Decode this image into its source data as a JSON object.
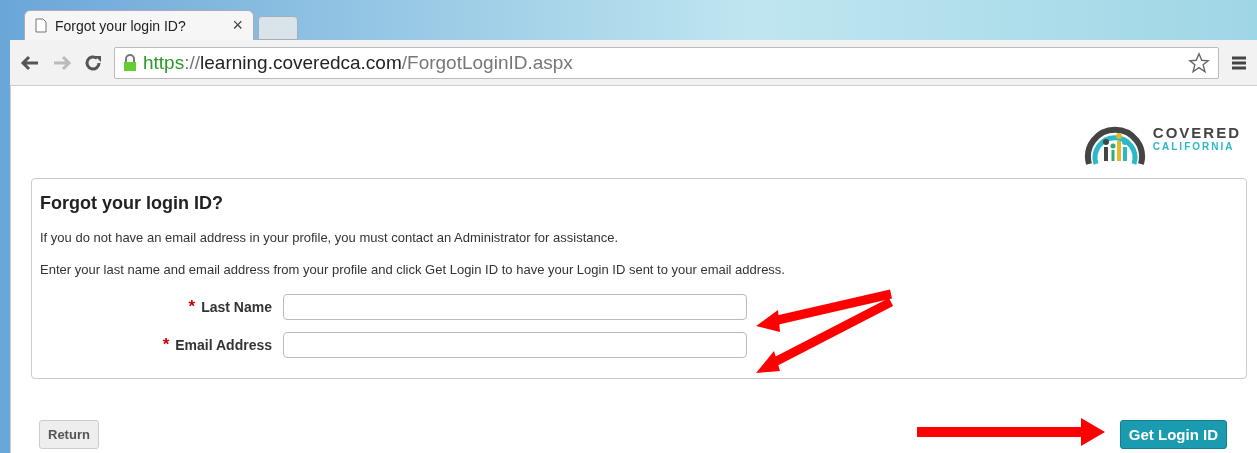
{
  "browser": {
    "tab_title": "Forgot your login ID?",
    "tab_close": "×",
    "url": [
      {
        "kind": "scheme",
        "text": "https"
      },
      {
        "kind": "sep",
        "text": "://"
      },
      {
        "kind": "host",
        "text": "learning.coveredca.com"
      },
      {
        "kind": "path",
        "text": "/ForgotLoginID.aspx"
      }
    ]
  },
  "logo": {
    "line1": "COVERED",
    "line2": "CALIFORNIA"
  },
  "form": {
    "title": "Forgot your login ID?",
    "notes": [
      "If you do not have an email address in your profile, you must contact an Administrator for assistance.",
      "Enter your last name and email address from your profile and click Get Login ID to have your Login ID sent to your email address."
    ],
    "fields": [
      {
        "marker": "*",
        "label": "Last Name"
      },
      {
        "marker": "*",
        "label": "Email Address"
      }
    ]
  },
  "buttons": [
    {
      "label": "Return",
      "kind": "secondary"
    },
    {
      "label": "Get Login ID",
      "kind": "primary"
    }
  ]
}
